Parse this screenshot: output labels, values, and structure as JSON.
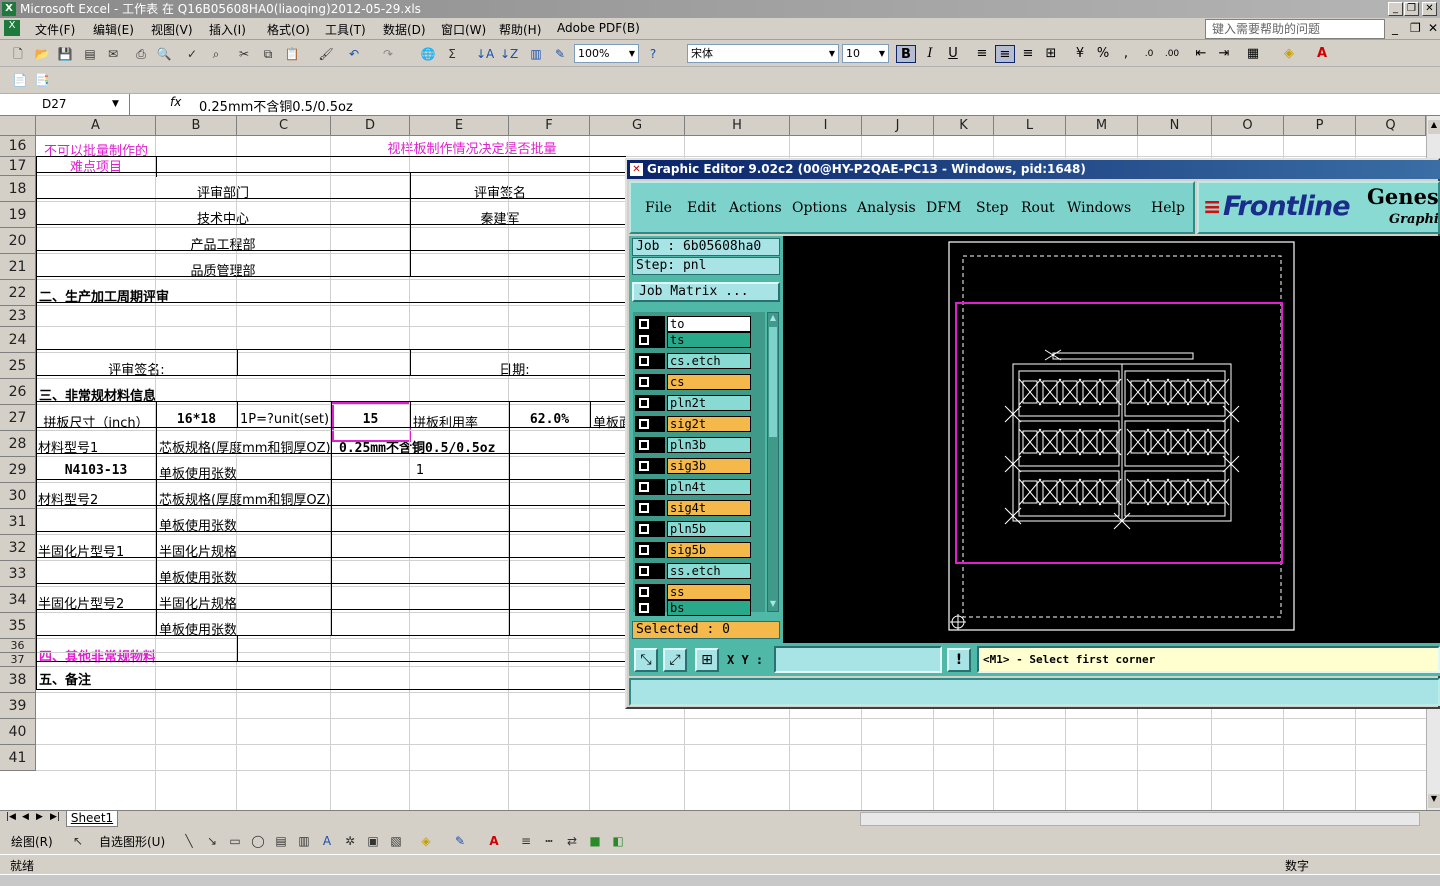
{
  "window": {
    "title": "Microsoft Excel - 工作表 在 Q16B05608HA0(liaoqing)2012-05-29.xls"
  },
  "menu": {
    "items": [
      "文件(F)",
      "编辑(E)",
      "视图(V)",
      "插入(I)",
      "格式(O)",
      "工具(T)",
      "数据(D)",
      "窗口(W)",
      "帮助(H)",
      "Adobe PDF(B)"
    ],
    "help_placeholder": "键入需要帮助的问题"
  },
  "toolbar": {
    "zoom": "100%",
    "font": "宋体",
    "size": "10"
  },
  "formula": {
    "cell": "D27",
    "fx": "fx",
    "value": "0.25mm不含铜0.5/0.5oz"
  },
  "columns": [
    "A",
    "B",
    "C",
    "D",
    "E",
    "F",
    "G",
    "H",
    "I",
    "J",
    "K",
    "L",
    "M",
    "N",
    "O",
    "P",
    "Q"
  ],
  "rows": [
    "16",
    "17",
    "18",
    "19",
    "20",
    "21",
    "22",
    "23",
    "24",
    "25",
    "26",
    "27",
    "28",
    "29",
    "30",
    "31",
    "32",
    "33",
    "34",
    "35",
    "36",
    "37",
    "38",
    "39",
    "40",
    "41"
  ],
  "cells": {
    "r16a": "不可以批量制作的",
    "r16a2": "难点项目",
    "r16b": "视样板制作情况决定是否批量",
    "r18b": "评审部门",
    "r18e": "评审签名",
    "r19b": "技术中心",
    "r19e": "秦建军",
    "r20b": "产品工程部",
    "r21b": "品质管理部",
    "r22": "二、生产加工周期评审",
    "r24a": "评审签名:",
    "r24e": "日期:",
    "r25": "三、非常规材料信息",
    "r26a": "拼板尺寸（inch）",
    "r26b": "16*18",
    "r26c": "1P=?unit(set)",
    "r26d": "15",
    "r26e": "拼板利用率",
    "r26f": "62.0%",
    "r26g": "单板面",
    "r27a": "材料型号1",
    "r27b": "芯板规格(厚度mm和铜厚OZ)",
    "r27d": "0.25mm不含铜0.5/0.5oz",
    "r28a": "N4103-13",
    "r28b": "单板使用张数",
    "r28d": "1",
    "r29a": "材料型号2",
    "r29b": "芯板规格(厚度mm和铜厚OZ)",
    "r30b": "单板使用张数",
    "r31a": "半固化片型号1",
    "r31b": "半固化片规格",
    "r32b": "单板使用张数",
    "r33a": "半固化片型号2",
    "r33b": "半固化片规格",
    "r34b": "单板使用张数",
    "r35": "四、其他非常规物料",
    "r36": "五、备注"
  },
  "sheet_tab": "Sheet1",
  "drawbar": {
    "draw": "绘图(R)",
    "autoshape": "自选图形(U)"
  },
  "status": {
    "left": "就绪",
    "right": "数字"
  },
  "ge": {
    "title": "Graphic Editor 9.02c2 (00@HY-P2QAE-PC13 - Windows, pid:1648)",
    "menu": [
      "File",
      "Edit",
      "Actions",
      "Options",
      "Analysis",
      "DFM",
      "Step",
      "Rout",
      "Windows",
      "Help"
    ],
    "logo": "Frontline",
    "logo2": "Genesis",
    "logo3": "Graphic",
    "job": "Job : 6b05608ha0",
    "step": "Step: pnl",
    "matrix": "Job Matrix ...",
    "layers": [
      {
        "name": "to",
        "color": "#ffffff"
      },
      {
        "name": "ts",
        "color": "#2aa88a"
      },
      {
        "name": "cs.etch",
        "color": "#8adad4"
      },
      {
        "name": "cs",
        "color": "#f5b84a"
      },
      {
        "name": "pln2t",
        "color": "#8adad4"
      },
      {
        "name": "sig2t",
        "color": "#f5b84a"
      },
      {
        "name": "pln3b",
        "color": "#8adad4"
      },
      {
        "name": "sig3b",
        "color": "#f5b84a"
      },
      {
        "name": "pln4t",
        "color": "#8adad4"
      },
      {
        "name": "sig4t",
        "color": "#f5b84a"
      },
      {
        "name": "pln5b",
        "color": "#8adad4"
      },
      {
        "name": "sig5b",
        "color": "#f5b84a"
      },
      {
        "name": "ss.etch",
        "color": "#8adad4"
      },
      {
        "name": "ss",
        "color": "#f5b84a"
      },
      {
        "name": "bs",
        "color": "#2aa88a"
      }
    ],
    "selected": "Selected : 0",
    "xy": "X Y :",
    "prompt": "<M1> - Select first corner"
  }
}
